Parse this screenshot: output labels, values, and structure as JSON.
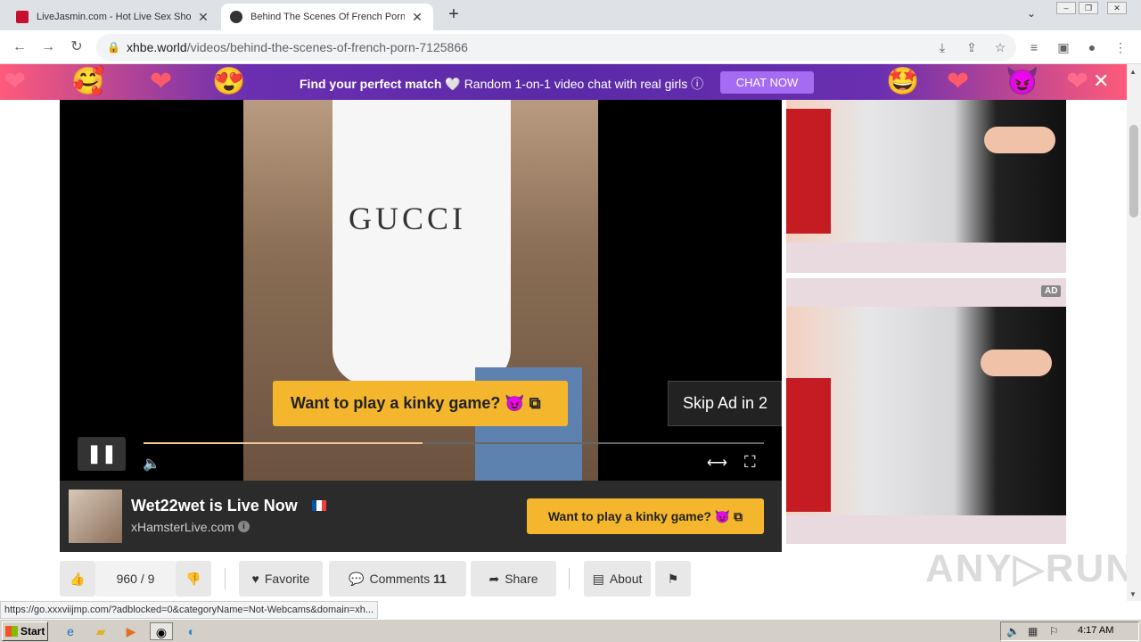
{
  "browser": {
    "tabs": [
      {
        "title": "LiveJasmin.com - Hot Live Sex Shows",
        "favicon_color": "#c8102e",
        "active": false
      },
      {
        "title": "Behind The Scenes Of French Porn |",
        "favicon_color": "#333333",
        "active": true
      }
    ],
    "new_tab": "+",
    "tab_search": "⌄",
    "url_host": "xhbe.world",
    "url_path": "/videos/behind-the-scenes-of-french-porn-7125866"
  },
  "promo": {
    "title": "Find your perfect match",
    "heart": "🤍",
    "text": "Random 1-on-1 video chat with real girls",
    "info": "ⓘ",
    "cta": "CHAT NOW",
    "close": "✕",
    "emojis": [
      "❤",
      "🥰",
      "❤",
      "😍",
      "🤩",
      "❤",
      "😈",
      "❤"
    ]
  },
  "player": {
    "overlay_cta": "Want to play a kinky game? 😈 ⧉",
    "skip_ad": "Skip Ad in 2",
    "progress": 0.45,
    "pause": "❚❚",
    "volume": "🔈",
    "expand": "⟷",
    "fullscreen": "⛶",
    "shirt_text": "GUCCI"
  },
  "live": {
    "title": "Wet22wet is Live Now",
    "site": "xHamsterLive.com",
    "info": "i",
    "cta": "Want to play a kinky game? 😈 ⧉"
  },
  "ads": {
    "badge": "AD"
  },
  "actions": {
    "likes": "960 / 9",
    "favorite": "Favorite",
    "comments_label": "Comments",
    "comments_count": "11",
    "share": "Share",
    "about": "About"
  },
  "watermark": "ANY▷RUN",
  "status_url": "https://go.xxxviijmp.com/?adblocked=0&categoryName=Not-Webcams&domain=xh...",
  "taskbar": {
    "start": "Start",
    "clock": "4:17 AM"
  },
  "colors": {
    "accent_yellow": "#f4b62d",
    "promo_purple": "#5a2aa8",
    "chat_now": "#a56bf2"
  }
}
